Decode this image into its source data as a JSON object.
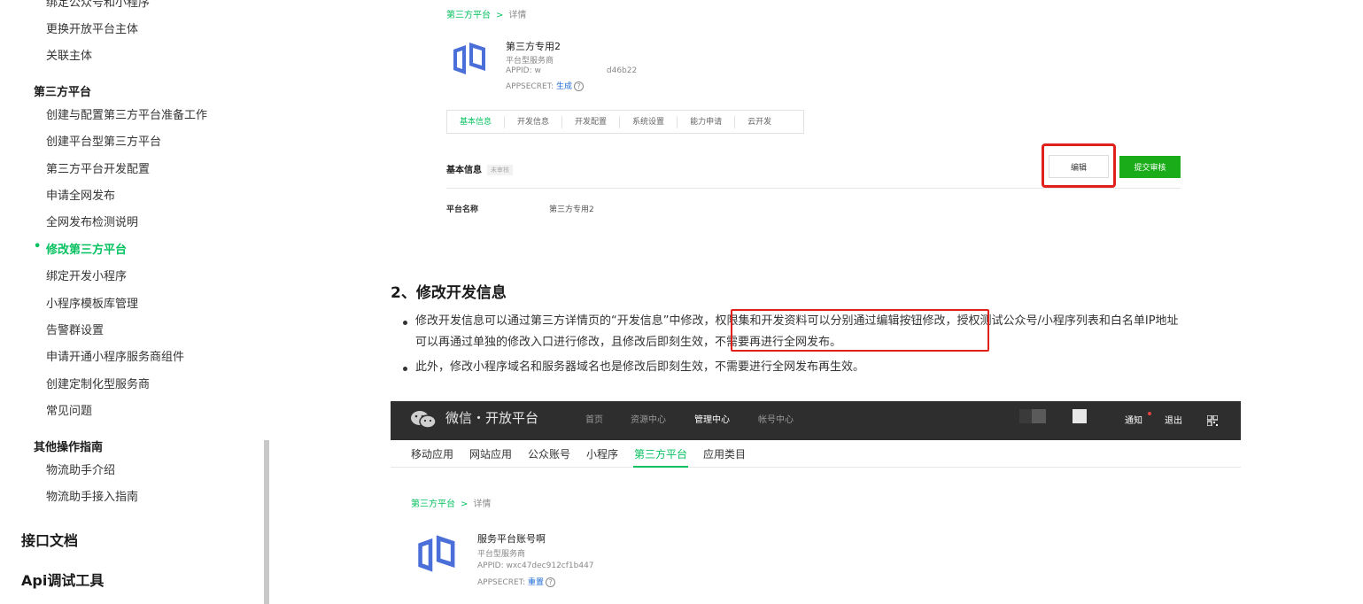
{
  "sidebar": {
    "items_top": [
      {
        "label": "绑定公众号和小程序"
      },
      {
        "label": "更换开放平台主体"
      },
      {
        "label": "关联主体"
      }
    ],
    "group_third_party": "第三方平台",
    "third_party_items": [
      {
        "label": "创建与配置第三方平台准备工作"
      },
      {
        "label": "创建平台型第三方平台"
      },
      {
        "label": "第三方平台开发配置"
      },
      {
        "label": "申请全网发布"
      },
      {
        "label": "全网发布检测说明"
      },
      {
        "label": "修改第三方平台",
        "active": true
      },
      {
        "label": "绑定开发小程序"
      },
      {
        "label": "小程序模板库管理"
      },
      {
        "label": "告警群设置"
      },
      {
        "label": "申请开通小程序服务商组件"
      },
      {
        "label": "创建定制化型服务商"
      },
      {
        "label": "常见问题"
      }
    ],
    "group_other": "其他操作指南",
    "other_items": [
      {
        "label": "物流助手介绍"
      },
      {
        "label": "物流助手接入指南"
      }
    ],
    "top_level": [
      {
        "label": "接口文档"
      },
      {
        "label": "Api调试工具"
      }
    ]
  },
  "shot1": {
    "breadcrumb_link": "第三方平台",
    "breadcrumb_sep": ">",
    "breadcrumb_current": "详情",
    "account_name": "第三方专用2",
    "account_type": "平台型服务商",
    "appid_label": "APPID: ",
    "appid_prefix": "w",
    "appid_suffix": "d46b22",
    "appsecret_label": "APPSECRET: ",
    "appsecret_action": "生成",
    "help_glyph": "?",
    "tabs": [
      "基本信息",
      "开发信息",
      "开发配置",
      "系统设置",
      "能力申请",
      "云开发"
    ],
    "section_title": "基本信息",
    "section_badge": "未审核",
    "edit_button": "编辑",
    "submit_button": "提交审核",
    "field_label": "平台名称",
    "field_value": "第三方专用2"
  },
  "doc": {
    "heading": "2、修改开发信息",
    "bullet1_part1": "修改开发信息可以通过第三方详情页的“开发信息”中修改，",
    "bullet1_highlight": "权限集和开发资料可以分别通过编辑按钮修改",
    "bullet1_part2": "，授权测试公众号/小程序列表和白名单IP地址",
    "bullet1_line2a": "可以再通过单独的修改入口进行修改，且修改后即刻生效，",
    "bullet1_line2_highlight": "不需要再进行全网发布。",
    "bullet2": "此外，修改小程序域名和服务器域名也是修改后即刻生效，不需要进行全网发布再生效。"
  },
  "shot2": {
    "brand": "微信・开放平台",
    "nav": [
      {
        "label": "首页"
      },
      {
        "label": "资源中心"
      },
      {
        "label": "管理中心",
        "active": true
      },
      {
        "label": "帐号中心"
      }
    ],
    "notify": "通知",
    "logout": "退出",
    "subnav": [
      {
        "label": "移动应用"
      },
      {
        "label": "网站应用"
      },
      {
        "label": "公众账号"
      },
      {
        "label": "小程序"
      },
      {
        "label": "第三方平台",
        "active": true
      },
      {
        "label": "应用类目"
      }
    ],
    "breadcrumb_link": "第三方平台",
    "breadcrumb_sep": ">",
    "breadcrumb_current": "详情",
    "account_name": "服务平台账号啊",
    "account_type": "平台型服务商",
    "appid": "APPID: wxc47dec912cf1b447",
    "appsecret_label": "APPSECRET: ",
    "appsecret_action": "重置",
    "help_glyph": "?"
  },
  "colors": {
    "accent_green": "#07c160",
    "highlight_red": "#e0201b",
    "topbar_dark": "#2e2e2e",
    "submit_green": "#1aad19",
    "logo_blue": "#4a6fd8"
  }
}
